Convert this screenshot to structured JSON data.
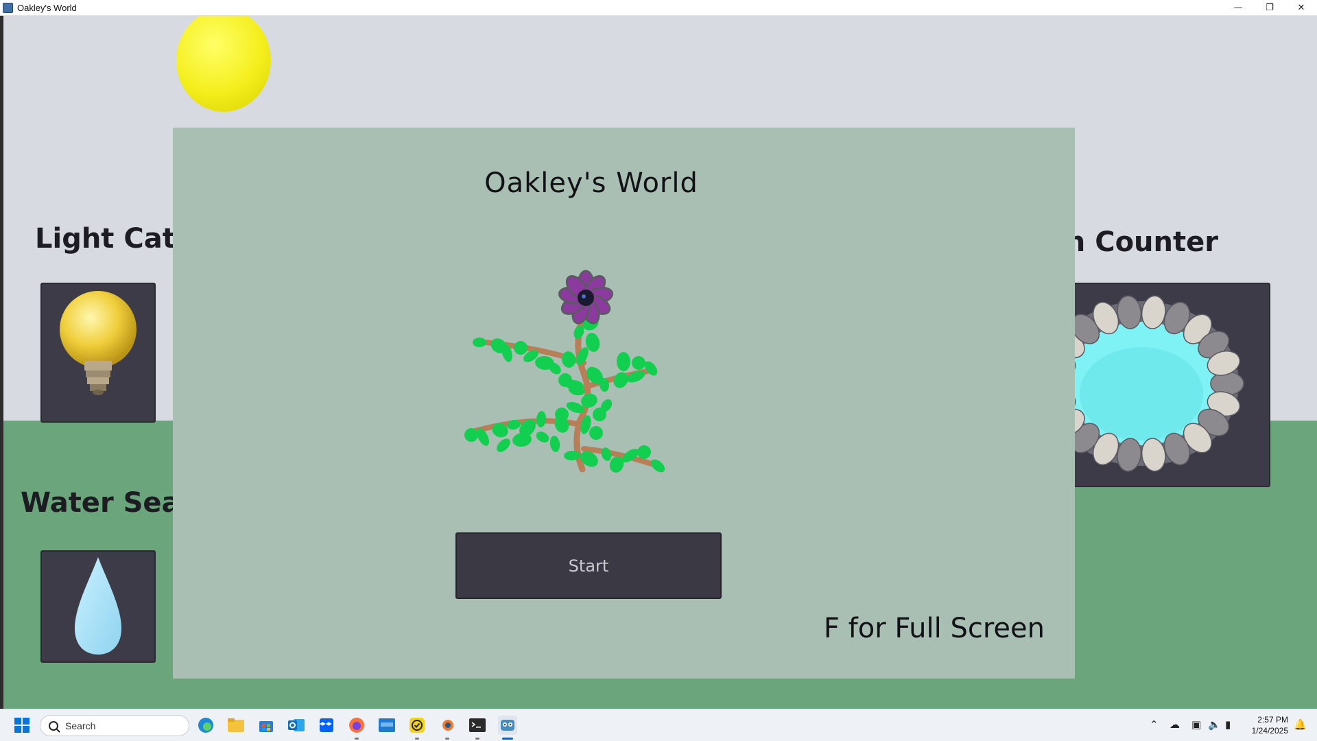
{
  "window": {
    "title": "Oakley's World",
    "minimize_icon": "minimize-icon",
    "restore_icon": "restore-icon",
    "close_icon": "close-icon"
  },
  "hud": {
    "light_label": "Light Catc",
    "water_label": "Water Sear",
    "fish_label": "sh Counter"
  },
  "panel": {
    "title": "Oakley's World",
    "start_label": "Start",
    "fullscreen_hint": "F for Full Screen"
  },
  "taskbar": {
    "search_placeholder": "Search",
    "time": "2:57 PM",
    "date": "1/24/2025"
  },
  "colors": {
    "sky": "#d7dae1",
    "ground": "#6aa57b",
    "panel": "#aabfb3",
    "card": "#3d3b47",
    "sun": "#f4ee1c",
    "leaf": "#13cf4f",
    "stem": "#b87e57",
    "petal": "#8c3aa0",
    "water": "#7ef2f4"
  }
}
